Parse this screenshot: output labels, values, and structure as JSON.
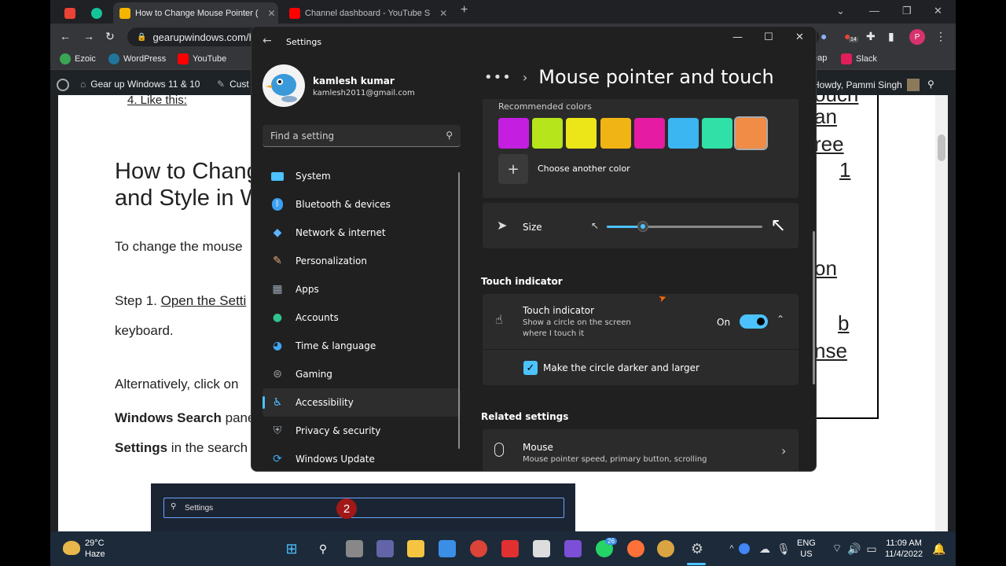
{
  "browser": {
    "tabs": [
      {
        "title": "",
        "icon": "gmail-icon",
        "color": "#ea4335"
      },
      {
        "title": "",
        "icon": "grammarly-icon",
        "color": "#15c39a"
      },
      {
        "title": "How to Change Mouse Pointer (",
        "icon": "gearup-icon",
        "color": "#f4b400",
        "active": true
      },
      {
        "title": "Channel dashboard - YouTube S",
        "icon": "youtube-icon",
        "color": "#ff0000"
      }
    ],
    "url": "gearupwindows.com/h",
    "bookmarks": [
      {
        "label": "Ezoic",
        "color": "#3aa655"
      },
      {
        "label": "WordPress",
        "color": "#21759b"
      },
      {
        "label": "YouTube",
        "color": "#ff0000"
      },
      {
        "label": "eap",
        "color": "#888888"
      },
      {
        "label": "Slack",
        "color": "#e01e5a"
      }
    ],
    "profile_letter": "P",
    "extension_badge": "14"
  },
  "wp_admin": {
    "site": "Gear up Windows 11 & 10",
    "customize": "Cust",
    "howdy": "Howdy, Pammi Singh"
  },
  "article": {
    "list_item": "4. Like this:",
    "title_line1": "How to Chang",
    "title_line2": "and Style in W",
    "p1": "To change the mouse",
    "p2a": "Step 1. ",
    "p2_link": "Open the Setti",
    "p2b": "keyboard.",
    "p3": "Alternatively, click on",
    "p4_bold": "Windows Search",
    "p4": " pane",
    "p5_bold": "Settings",
    "p5": " in the search",
    "right_fragments": [
      "ouch",
      "an",
      "ree",
      "1",
      "on",
      "b",
      "nse"
    ],
    "search_text": "Settings",
    "step_number": "2"
  },
  "settings": {
    "window_title": "Settings",
    "user_name": "kamlesh kumar",
    "user_email": "kamlesh2011@gmail.com",
    "search_placeholder": "Find a setting",
    "nav": [
      {
        "label": "System",
        "icon": "system-icon",
        "color": "#4cc2ff"
      },
      {
        "label": "Bluetooth & devices",
        "icon": "bluetooth-icon",
        "color": "#3b9ef0"
      },
      {
        "label": "Network & internet",
        "icon": "network-icon",
        "color": "#5ab4ff"
      },
      {
        "label": "Personalization",
        "icon": "brush-icon",
        "color": "#e8a87c"
      },
      {
        "label": "Apps",
        "icon": "apps-icon",
        "color": "#9aa6b5"
      },
      {
        "label": "Accounts",
        "icon": "accounts-icon",
        "color": "#2fc48d"
      },
      {
        "label": "Time & language",
        "icon": "globe-icon",
        "color": "#3ea8f0"
      },
      {
        "label": "Gaming",
        "icon": "gamepad-icon",
        "color": "#a0a0a0"
      },
      {
        "label": "Accessibility",
        "icon": "accessibility-icon",
        "color": "#4cc2ff",
        "active": true
      },
      {
        "label": "Privacy & security",
        "icon": "shield-icon",
        "color": "#9aa0a6"
      },
      {
        "label": "Windows Update",
        "icon": "update-icon",
        "color": "#3ea8f0"
      }
    ],
    "breadcrumb_title": "Mouse pointer and touch",
    "recommended_colors_label": "Recommended colors",
    "recommended_colors": [
      "#c41ee0",
      "#b6e51b",
      "#ece619",
      "#f0b414",
      "#e51ba4",
      "#3cb6f0",
      "#30e0a6",
      "#f08c46"
    ],
    "choose_another_color": "Choose another color",
    "size_label": "Size",
    "size_level": 0.23,
    "touch_section": "Touch indicator",
    "touch_title": "Touch indicator",
    "touch_desc_line1": "Show a circle on the screen",
    "touch_desc_line2": "where I touch it",
    "touch_state": "On",
    "darker_label": "Make the circle darker and larger",
    "related_section": "Related settings",
    "mouse_title": "Mouse",
    "mouse_desc": "Mouse pointer speed, primary button, scrolling"
  },
  "taskbar": {
    "temp": "29°C",
    "weather": "Haze",
    "lang1": "ENG",
    "lang2": "US",
    "time": "11:09 AM",
    "date": "11/4/2022",
    "whatsapp_badge": "26"
  }
}
